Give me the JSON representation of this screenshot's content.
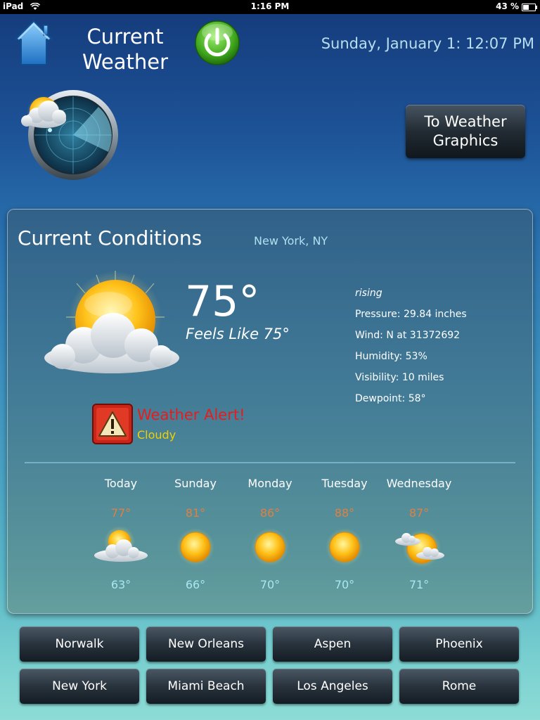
{
  "status_bar": {
    "device": "iPad",
    "time": "1:16 PM",
    "battery": "43 %",
    "battery_level": 0.43
  },
  "header": {
    "title": "Current Weather",
    "datetime": "Sunday, January 1: 12:07 PM",
    "graphics_button": "To Weather Graphics"
  },
  "conditions": {
    "title": "Current Conditions",
    "location": "New York, NY",
    "temperature": "75°",
    "feels_like": "Feels Like 75°",
    "pressure_trend": "rising",
    "pressure": "Pressure: 29.84 inches",
    "wind": "Wind: N at 31372692",
    "humidity": "Humidity: 53%",
    "visibility": "Visibility: 10 miles",
    "dewpoint": "Dewpoint: 58°",
    "alert_title": "Weather Alert!",
    "alert_condition": "Cloudy"
  },
  "forecast": [
    {
      "day": "Today",
      "high": "77°",
      "low": "63°",
      "icon": "partly-cloudy-icon"
    },
    {
      "day": "Sunday",
      "high": "81°",
      "low": "66°",
      "icon": "sunny-icon"
    },
    {
      "day": "Monday",
      "high": "86°",
      "low": "70°",
      "icon": "sunny-icon"
    },
    {
      "day": "Tuesday",
      "high": "88°",
      "low": "70°",
      "icon": "sunny-icon"
    },
    {
      "day": "Wednesday",
      "high": "87°",
      "low": "71°",
      "icon": "partly-cloudy-icon"
    }
  ],
  "cities": [
    "Norwalk",
    "New Orleans",
    "Aspen",
    "Phoenix",
    "New York",
    "Miami Beach",
    "Los Angeles",
    "Rome"
  ],
  "colors": {
    "high_temp": "#e08040",
    "low_temp": "#a8e8f2",
    "alert": "#e81c1c",
    "alert_condition": "#f0d000",
    "location": "#aee0f0",
    "datetime": "#b8def0"
  }
}
